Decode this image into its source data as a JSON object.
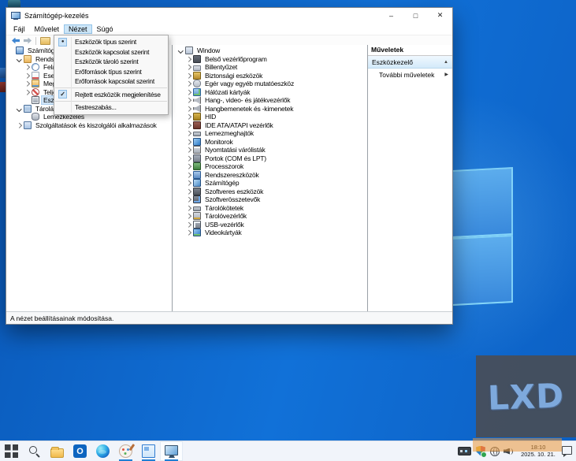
{
  "window": {
    "title": "Számítógép-kezelés",
    "controls": {
      "minimize": "–",
      "maximize": "□",
      "close": "✕"
    },
    "menus": [
      {
        "label": "Fájl",
        "active": false
      },
      {
        "label": "Művelet",
        "active": false
      },
      {
        "label": "Nézet",
        "active": true
      },
      {
        "label": "Súgó",
        "active": false
      }
    ],
    "toolbar_icons": [
      "back-arrow",
      "forward-arrow",
      "export-folder",
      "properties-window"
    ]
  },
  "view_menu": {
    "items": [
      {
        "type": "item",
        "label": "Eszközök típus szerint",
        "mark": "radio"
      },
      {
        "type": "item",
        "label": "Eszközök kapcsolat szerint",
        "mark": null
      },
      {
        "type": "item",
        "label": "Eszközök tároló szerint",
        "mark": null
      },
      {
        "type": "item",
        "label": "Erőforrások típus szerint",
        "mark": null
      },
      {
        "type": "item",
        "label": "Erőforrások kapcsolat szerint",
        "mark": null
      },
      {
        "type": "sep"
      },
      {
        "type": "item",
        "label": "Rejtett eszközök megjelenítése",
        "mark": "check"
      },
      {
        "type": "sep"
      },
      {
        "type": "item",
        "label": "Testreszabás...",
        "mark": null
      }
    ],
    "marks": {
      "radio": "●",
      "check": "✓"
    }
  },
  "console_tree": {
    "items": [
      {
        "label": "Számítógép-kezelés",
        "level": 0,
        "expand": "",
        "icon": "mgmt"
      },
      {
        "label": "Rendszereszközök",
        "level": 1,
        "expand": "down",
        "icon": "systools"
      },
      {
        "label": "Feladatütemező",
        "level": 2,
        "expand": "right",
        "icon": "scheduler"
      },
      {
        "label": "Eseménynapló",
        "level": 2,
        "expand": "right",
        "icon": "events"
      },
      {
        "label": "Megosztott mappák",
        "level": 2,
        "expand": "right",
        "icon": "shared"
      },
      {
        "label": "Teljesítmény",
        "level": 2,
        "expand": "right",
        "icon": "perf"
      },
      {
        "label": "Eszközkezelő",
        "level": 2,
        "expand": "",
        "icon": "devmgr",
        "selected": true
      },
      {
        "label": "Tárolás",
        "level": 1,
        "expand": "down",
        "icon": "storage"
      },
      {
        "label": "Lemezkezelés",
        "level": 2,
        "expand": "",
        "icon": "diskmgmt"
      },
      {
        "label": "Szolgáltatások és kiszolgálói alkalmazások",
        "level": 1,
        "expand": "right",
        "icon": "services"
      }
    ]
  },
  "device_tree": {
    "root": {
      "label": "Window",
      "icon": "pc"
    },
    "categories": [
      {
        "label": "Belső vezérlőprogram",
        "icon": "firmware"
      },
      {
        "label": "Billentyűzet",
        "icon": "keyboard"
      },
      {
        "label": "Biztonsági eszközök",
        "icon": "security"
      },
      {
        "label": "Egér vagy egyéb mutatóeszköz",
        "icon": "mouse"
      },
      {
        "label": "Hálózati kártyák",
        "icon": "network"
      },
      {
        "label": "Hang-, video- és játékvezérlők",
        "icon": "sound"
      },
      {
        "label": "Hangbemenetek és -kimenetek",
        "icon": "audio"
      },
      {
        "label": "HID",
        "icon": "hid"
      },
      {
        "label": "IDE ATA/ATAPI vezérlők",
        "icon": "ide"
      },
      {
        "label": "Lemezmeghajtók",
        "icon": "diskdrive"
      },
      {
        "label": "Monitorok",
        "icon": "monitor"
      },
      {
        "label": "Nyomtatási várólisták",
        "icon": "printer"
      },
      {
        "label": "Portok (COM és LPT)",
        "icon": "ports"
      },
      {
        "label": "Processzorok",
        "icon": "cpu"
      },
      {
        "label": "Rendszereszközök",
        "icon": "sysdev"
      },
      {
        "label": "Számítógép",
        "icon": "computer"
      },
      {
        "label": "Szoftveres eszközök",
        "icon": "softdev"
      },
      {
        "label": "Szoftverösszetevők",
        "icon": "softcomp"
      },
      {
        "label": "Tárolókötetek",
        "icon": "volumes"
      },
      {
        "label": "Tárolóvezérlők",
        "icon": "storagectl"
      },
      {
        "label": "USB-vezérlők",
        "icon": "usb"
      },
      {
        "label": "Videokártyák",
        "icon": "gpu"
      }
    ]
  },
  "actions_pane": {
    "title": "Műveletek",
    "section_label": "Eszközkezelő",
    "collapse_glyph": "▲",
    "more_label": "További műveletek",
    "submenu_glyph": "▶"
  },
  "status_bar": {
    "text": "A nézet beállításainak módosítása."
  },
  "taskbar": {
    "apps": [
      {
        "name": "start",
        "running": false,
        "active": false
      },
      {
        "name": "search",
        "running": false,
        "active": false
      },
      {
        "name": "file-explorer",
        "running": false,
        "active": false
      },
      {
        "name": "outlook",
        "running": false,
        "active": false
      },
      {
        "name": "edge",
        "running": false,
        "active": false
      },
      {
        "name": "paint",
        "running": true,
        "active": false
      },
      {
        "name": "window-app",
        "running": true,
        "active": false
      },
      {
        "name": "computer-management",
        "running": true,
        "active": true
      }
    ],
    "tray_icons": [
      "utility",
      "shield",
      "globe",
      "speaker"
    ],
    "clock": {
      "time": "18:10",
      "date": "2025. 10. 21."
    }
  },
  "watermark": {
    "text": "LXD"
  },
  "colors": {
    "desktop_base": "#0d64c8",
    "logo_pane": "#3c93e8",
    "accent": "#1f7fd4",
    "menu_selection": "#cde6f8",
    "tray_highlight": "#e9983a"
  }
}
